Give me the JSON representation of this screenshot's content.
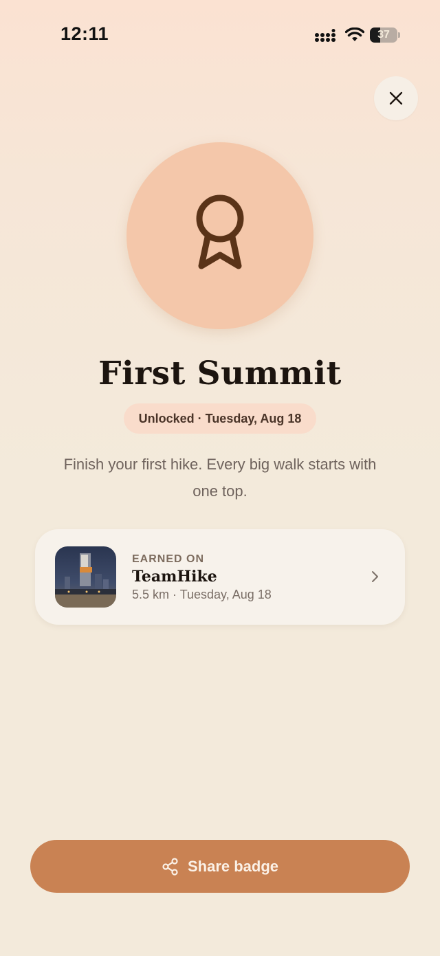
{
  "status_bar": {
    "time": "12:11",
    "battery_level": 37,
    "battery_text": "37",
    "icons": [
      "signal-icon",
      "wifi-icon",
      "battery-icon"
    ]
  },
  "header": {
    "close_icon": "close-icon"
  },
  "badge": {
    "icon": "award-ribbon-icon",
    "title": "First Summit",
    "unlocked_label": "Unlocked · Tuesday, Aug 18",
    "description": "Finish your first hike. Every big walk starts with one top."
  },
  "earned_on": {
    "label": "EARNED ON",
    "activity_name": "TeamHike",
    "activity_meta": "5.5 km · Tuesday, Aug 18",
    "chevron_icon": "chevron-right-icon"
  },
  "share": {
    "label": "Share badge",
    "icon": "share-icon"
  },
  "colors": {
    "accent": "#c98253",
    "medallion": "#f4c7aa",
    "icon_brown": "#5a3318",
    "pill_bg": "#f9dccb",
    "card_bg": "#f7f2eb"
  }
}
